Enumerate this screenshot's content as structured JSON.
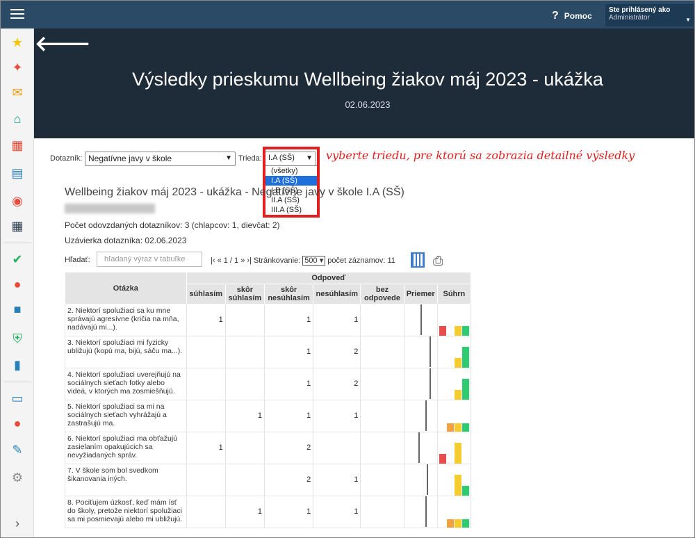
{
  "topbar": {
    "help_label": "Pomoc",
    "user_line1": "Ste prihlásený ako",
    "user_line2": "Administrátor"
  },
  "header": {
    "title": "Výsledky prieskumu Wellbeing žiakov máj 2023 - ukážka",
    "date": "02.06.2023"
  },
  "filters": {
    "dotaznik_label": "Dotazník:",
    "dotaznik_value": "Negatívne javy v škole",
    "trieda_label": "Trieda:",
    "trieda_value": "I.A (SŠ)",
    "trieda_options": [
      "(všetky)",
      "I.A (SŠ)",
      "I.B (SŠ)",
      "II.A (SŠ)",
      "III.A (SŠ)"
    ]
  },
  "annotation": "vyberte triedu, pre ktorú sa zobrazia detailné výsledky",
  "report": {
    "heading": "Wellbeing žiakov máj 2023 - ukážka  - Negatívne javy v škole I.A (SŠ)",
    "count_text": "Počet odovzdaných dotazníkov: 3 (chlapcov: 1, dievčat: 2)",
    "deadline_text": "Uzávierka dotazníka: 02.06.2023"
  },
  "search": {
    "label": "Hľadať:",
    "placeholder": "hľadaný výraz v tabuľke"
  },
  "pagination": {
    "nav": "|‹ « 1 / 1 » ›|",
    "paging_label": "Stránkovanie:",
    "paging_value": "500",
    "records": "počet záznamov: 11"
  },
  "table": {
    "header_question": "Otázka",
    "header_group": "Odpoveď",
    "columns": [
      "súhlasím",
      "skôr súhlasím",
      "skôr nesúhlasím",
      "nesúhlasím",
      "bez odpovede",
      "Priemer",
      "Súhrn"
    ],
    "rows": [
      {
        "q": "2. Niektorí spolužiaci sa ku mne správajú agresívne (kričia na mňa, nadávajú mi...).",
        "v": [
          "1",
          "",
          "1",
          "1",
          ""
        ],
        "avg": 0.5,
        "bars": [
          {
            "h": 14,
            "c": "#e84d4d"
          },
          {
            "h": 0,
            "c": "#f5a142"
          },
          {
            "h": 14,
            "c": "#f5cc30"
          },
          {
            "h": 14,
            "c": "#2ecc71"
          }
        ]
      },
      {
        "q": "3. Niektorí spolužiaci mi fyzicky ubližujú (kopú ma, bijú, sáču ma...).",
        "v": [
          "",
          "",
          "1",
          "2",
          ""
        ],
        "avg": 0.8,
        "bars": [
          {
            "h": 0,
            "c": "#e84d4d"
          },
          {
            "h": 0,
            "c": "#f5a142"
          },
          {
            "h": 14,
            "c": "#f5cc30"
          },
          {
            "h": 30,
            "c": "#2ecc71"
          }
        ]
      },
      {
        "q": "4. Niektorí spolužiaci uverejňujú na sociálnych sieťach fotky alebo videá, v ktorých ma zosmiešňujú.",
        "v": [
          "",
          "",
          "1",
          "2",
          ""
        ],
        "avg": 0.8,
        "bars": [
          {
            "h": 0,
            "c": "#e84d4d"
          },
          {
            "h": 0,
            "c": "#f5a142"
          },
          {
            "h": 14,
            "c": "#f5cc30"
          },
          {
            "h": 30,
            "c": "#2ecc71"
          }
        ]
      },
      {
        "q": "5. Niektorí spolužiaci sa mi na sociálnych sieťach vyhrážajú a zastrašujú ma.",
        "v": [
          "",
          "1",
          "1",
          "1",
          ""
        ],
        "avg": 0.65,
        "bars": [
          {
            "h": 0,
            "c": "#e84d4d"
          },
          {
            "h": 12,
            "c": "#f5a142"
          },
          {
            "h": 12,
            "c": "#f5cc30"
          },
          {
            "h": 12,
            "c": "#2ecc71"
          }
        ]
      },
      {
        "q": "6. Niektorí spolužiaci ma obťažujú zasielaním opakujúcich sa nevyžiadaných správ.",
        "v": [
          "1",
          "",
          "2",
          "",
          ""
        ],
        "avg": 0.45,
        "bars": [
          {
            "h": 14,
            "c": "#e84d4d"
          },
          {
            "h": 0,
            "c": "#f5a142"
          },
          {
            "h": 30,
            "c": "#f5cc30"
          },
          {
            "h": 0,
            "c": "#2ecc71"
          }
        ]
      },
      {
        "q": "7. V škole som bol svedkom šikanovania iných.",
        "v": [
          "",
          "",
          "2",
          "1",
          ""
        ],
        "avg": 0.7,
        "bars": [
          {
            "h": 0,
            "c": "#e84d4d"
          },
          {
            "h": 0,
            "c": "#f5a142"
          },
          {
            "h": 30,
            "c": "#f5cc30"
          },
          {
            "h": 14,
            "c": "#2ecc71"
          }
        ]
      },
      {
        "q": "8. Pociťujem úzkosť, keď mám ísť do školy, pretože niektorí spolužiaci sa mi posmievajú alebo mi ubližujú.",
        "v": [
          "",
          "1",
          "1",
          "1",
          ""
        ],
        "avg": 0.65,
        "bars": [
          {
            "h": 0,
            "c": "#e84d4d"
          },
          {
            "h": 12,
            "c": "#f5a142"
          },
          {
            "h": 12,
            "c": "#f5cc30"
          },
          {
            "h": 12,
            "c": "#2ecc71"
          }
        ]
      }
    ]
  }
}
